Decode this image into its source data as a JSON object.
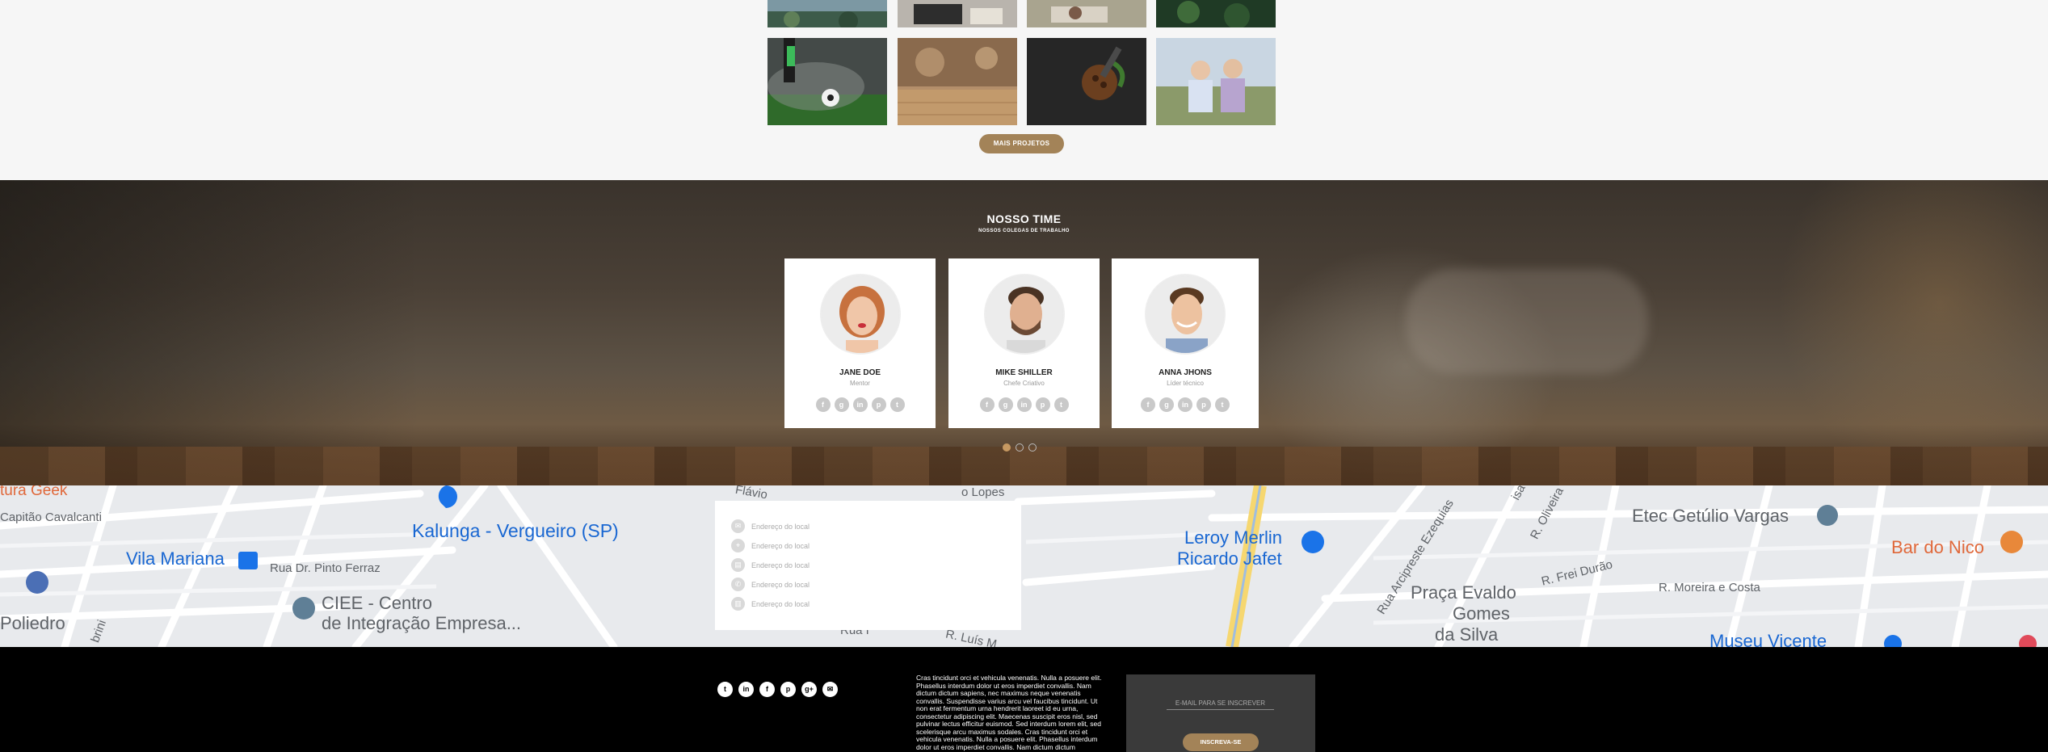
{
  "portfolio": {
    "more_button": "MAIS PROJETOS"
  },
  "team": {
    "title": "NOSSO TIME",
    "subtitle": "NOSSOS COLEGAS DE TRABALHO",
    "members": [
      {
        "name": "JANE DOE",
        "role": "Mentor"
      },
      {
        "name": "MIKE SHILLER",
        "role": "Chefe Criativo"
      },
      {
        "name": "ANNA JHONS",
        "role": "Líder técnico"
      }
    ],
    "social_icons": [
      "facebook-icon",
      "google-plus-icon",
      "linkedin-icon",
      "pinterest-icon",
      "twitter-icon"
    ],
    "social_glyphs": [
      "f",
      "g",
      "in",
      "p",
      "t"
    ],
    "active_slide": 1,
    "slide_count": 3
  },
  "map": {
    "places": [
      {
        "label": "tura Geek",
        "color": "#e0683a"
      },
      {
        "label": "Capitão Cavalcanti",
        "color": "#5f6368"
      },
      {
        "label": "Kalunga - Vergueiro (SP)",
        "color": "#1967d2"
      },
      {
        "label": "Vila Mariana",
        "color": "#1967d2"
      },
      {
        "label": "Rua Dr. Pinto Ferraz",
        "color": "#5f6368"
      },
      {
        "label": "CIEE - Centro",
        "color": "#5f6368"
      },
      {
        "label": "de Integração Empresa...",
        "color": "#5f6368"
      },
      {
        "label": "Poliedro",
        "color": "#5f6368"
      },
      {
        "label": "Leroy Merlin",
        "color": "#1967d2"
      },
      {
        "label": "Ricardo Jafet",
        "color": "#1967d2"
      },
      {
        "label": "Praça Evaldo",
        "color": "#5f6368"
      },
      {
        "label": "Gomes",
        "color": "#5f6368"
      },
      {
        "label": "da Silva",
        "color": "#5f6368"
      },
      {
        "label": "Etec Getúlio Vargas",
        "color": "#5f6368"
      },
      {
        "label": "Bar do Nico",
        "color": "#e0683a"
      },
      {
        "label": "Museu Vicente",
        "color": "#1967d2"
      },
      {
        "label": "R. Moreira e Costa",
        "color": "#5f6368"
      },
      {
        "label": "R. Frei Durão",
        "color": "#5f6368"
      },
      {
        "label": "R. Oliveira",
        "color": "#5f6368"
      },
      {
        "label": "Rua Arcipreste Ezequias",
        "color": "#5f6368"
      },
      {
        "label": "R. Luís M",
        "color": "#5f6368"
      },
      {
        "label": "Rua I",
        "color": "#5f6368"
      },
      {
        "label": "Flávio",
        "color": "#5f6368"
      },
      {
        "label": "o Lopes",
        "color": "#5f6368"
      },
      {
        "label": "brini",
        "color": "#5f6368"
      },
      {
        "label": "isa",
        "color": "#5f6368"
      }
    ]
  },
  "contact": {
    "items": [
      {
        "icon": "email-icon",
        "glyph": "✉",
        "text": "Endereço do local"
      },
      {
        "icon": "location-pin-icon",
        "glyph": "⌖",
        "text": "Endereço do local"
      },
      {
        "icon": "calendar-icon",
        "glyph": "▤",
        "text": "Endereço do local"
      },
      {
        "icon": "phone-icon",
        "glyph": "✆",
        "text": "Endereço do local"
      },
      {
        "icon": "printer-icon",
        "glyph": "▥",
        "text": "Endereço do local"
      }
    ]
  },
  "footer": {
    "social_icons": [
      "twitter-icon",
      "linkedin-icon",
      "facebook-icon",
      "pinterest-icon",
      "google-plus-icon",
      "email-icon"
    ],
    "social_glyphs": [
      "t",
      "in",
      "f",
      "p",
      "g+",
      "✉"
    ],
    "text": "Cras tincidunt orci et vehicula venenatis. Nulla a posuere elit. Phasellus interdum dolor ut eros imperdiet convallis. Nam dictum dictum sapiens, nec maximus neque venenatis convallis. Suspendisse varius arcu vel faucibus tincidunt. Ut non erat fermentum urna hendrerit laoreet id eu urna, consectetur adipiscing elit. Maecenas suscipit eros nisl, sed pulvinar lectus efficitur euismod. Sed interdum lorem elit, sed scelerisque arcu maximus sodales. Cras tincidunt orci et vehicula venenatis. Nulla a posuere elit. Phasellus interdum dolor ut eros imperdiet convallis. Nam dictum dictum",
    "newsletter_placeholder": "E-MAIL PARA SE INSCREVER",
    "newsletter_button": "INSCREVA-SE"
  }
}
